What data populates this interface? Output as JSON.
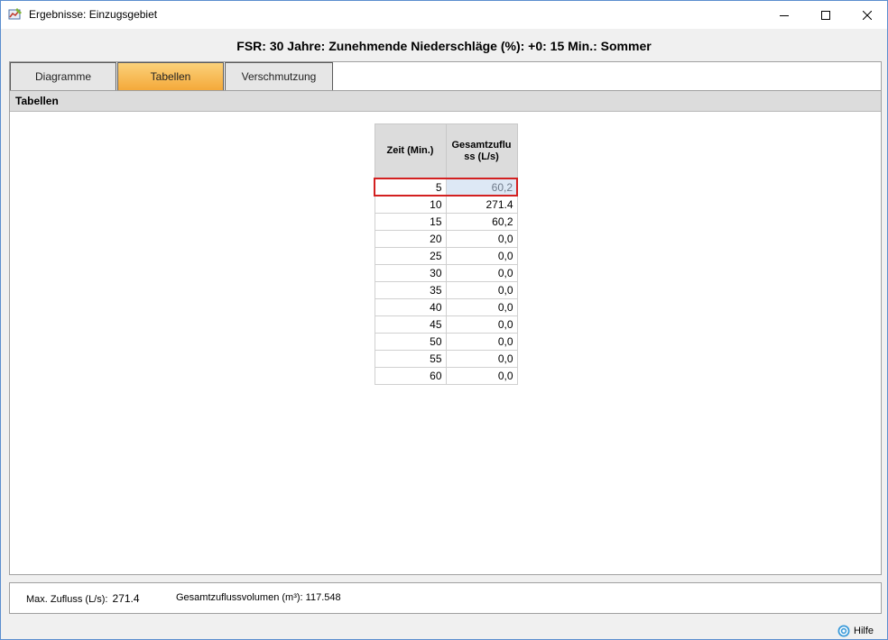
{
  "window": {
    "title": "Ergebnisse: Einzugsgebiet",
    "icon": "app-chart-icon"
  },
  "scenario_title": "FSR: 30 Jahre: Zunehmende Niederschläge (%): +0: 15 Min.: Sommer",
  "tabs": [
    {
      "label": "Diagramme",
      "active": false
    },
    {
      "label": "Tabellen",
      "active": true
    },
    {
      "label": "Verschmutzung",
      "active": false
    }
  ],
  "panel": {
    "header": "Tabellen"
  },
  "table": {
    "columns": [
      "Zeit (Min.)",
      "Gesamtzufluss (L/s)"
    ],
    "rows": [
      [
        "5",
        "60,2"
      ],
      [
        "10",
        "271.4"
      ],
      [
        "15",
        "60,2"
      ],
      [
        "20",
        "0,0"
      ],
      [
        "25",
        "0,0"
      ],
      [
        "30",
        "0,0"
      ],
      [
        "35",
        "0,0"
      ],
      [
        "40",
        "0,0"
      ],
      [
        "45",
        "0,0"
      ],
      [
        "50",
        "0,0"
      ],
      [
        "55",
        "0,0"
      ],
      [
        "60",
        "0,0"
      ]
    ],
    "selected_row": 0
  },
  "status": {
    "max_label": "Max. Zufluss (L/s):",
    "max_value": "271.4",
    "volume_label": "Gesamtzuflussvolumen (m³):",
    "volume_value": "117.548"
  },
  "help": {
    "label": "Hilfe",
    "icon": "help-icon"
  },
  "colors": {
    "tab_active_top": "#fbd17a",
    "tab_active_bottom": "#f4a93a",
    "selection_border": "#d32020",
    "selected_cell_bg": "#dde8f5"
  }
}
